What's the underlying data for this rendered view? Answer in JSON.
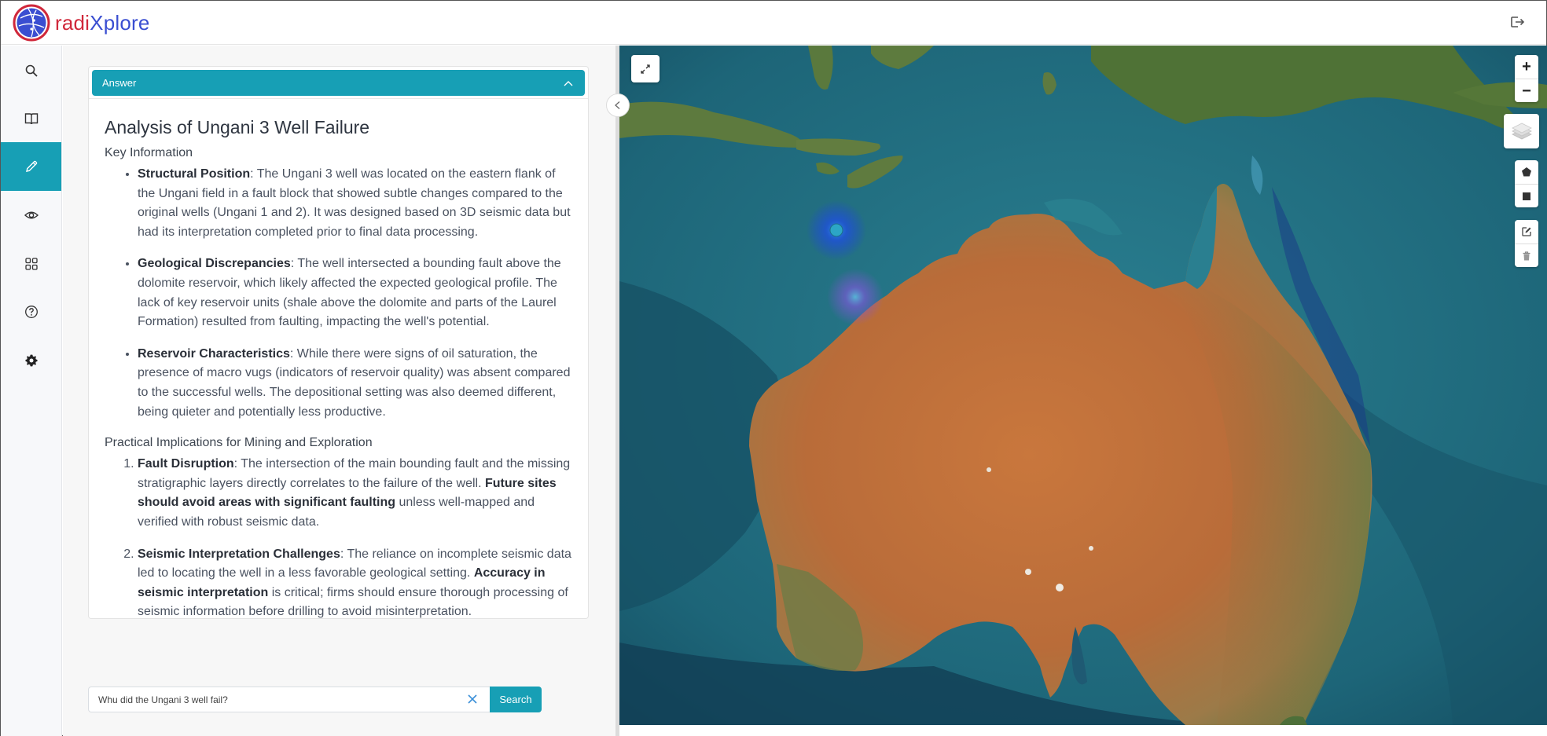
{
  "app": {
    "brand_part1": "radi",
    "brand_part2": "Xplore",
    "colors": {
      "accent": "#179fb5",
      "brand_red": "#d0283b",
      "brand_blue": "#3a4ed1"
    }
  },
  "header": {
    "logout_icon": "logout-icon"
  },
  "sidebar": {
    "items": [
      {
        "id": "search",
        "icon": "search-icon",
        "active": false
      },
      {
        "id": "library",
        "icon": "book-icon",
        "active": false
      },
      {
        "id": "ask",
        "icon": "pencil-icon",
        "active": true
      },
      {
        "id": "view",
        "icon": "eye-icon",
        "active": false
      },
      {
        "id": "apps",
        "icon": "grid-icon",
        "active": false
      },
      {
        "id": "help",
        "icon": "help-circle-icon",
        "active": false
      },
      {
        "id": "settings",
        "icon": "gear-icon",
        "active": false
      }
    ]
  },
  "answer": {
    "header_label": "Answer",
    "title": "Analysis of Ungani 3 Well Failure",
    "section1_heading": "Key Information",
    "key_points": [
      {
        "term": "Structural Position",
        "text": ": The Ungani 3 well was located on the eastern flank of the Ungani field in a fault block that showed subtle changes compared to the original wells (Ungani 1 and 2). It was designed based on 3D seismic data but had its interpretation completed prior to final data processing."
      },
      {
        "term": "Geological Discrepancies",
        "text": ": The well intersected a bounding fault above the dolomite reservoir, which likely affected the expected geological profile. The lack of key reservoir units (shale above the dolomite and parts of the Laurel Formation) resulted from faulting, impacting the well's potential."
      },
      {
        "term": "Reservoir Characteristics",
        "text": ": While there were signs of oil saturation, the presence of macro vugs (indicators of reservoir quality) was absent compared to the successful wells. The depositional setting was also deemed different, being quieter and potentially less productive."
      }
    ],
    "section2_heading": "Practical Implications for Mining and Exploration",
    "implications": [
      {
        "term": "Fault Disruption",
        "text_a": ": The intersection of the main bounding fault and the missing stratigraphic layers directly correlates to the failure of the well. ",
        "emph": "Future sites should avoid areas with significant faulting",
        "text_b": " unless well-mapped and verified with robust seismic data."
      },
      {
        "term": "Seismic Interpretation Challenges",
        "text_a": ": The reliance on incomplete seismic data led to locating the well in a less favorable geological setting. ",
        "emph": "Accuracy in seismic interpretation",
        "text_b": " is critical; firms should ensure thorough processing of seismic information before drilling to avoid misinterpretation."
      }
    ]
  },
  "search": {
    "value": "Whu did the Ungani 3 well fail?",
    "button_label": "Search",
    "clear_icon": "close-icon"
  },
  "map": {
    "region": "Australia",
    "zoom_in_label": "+",
    "zoom_out_label": "−",
    "markers": [
      {
        "name": "offshore-well-marker",
        "color": "#1e6fe0"
      },
      {
        "name": "ungani-well-heat",
        "color": "#8a4fd6"
      }
    ]
  }
}
